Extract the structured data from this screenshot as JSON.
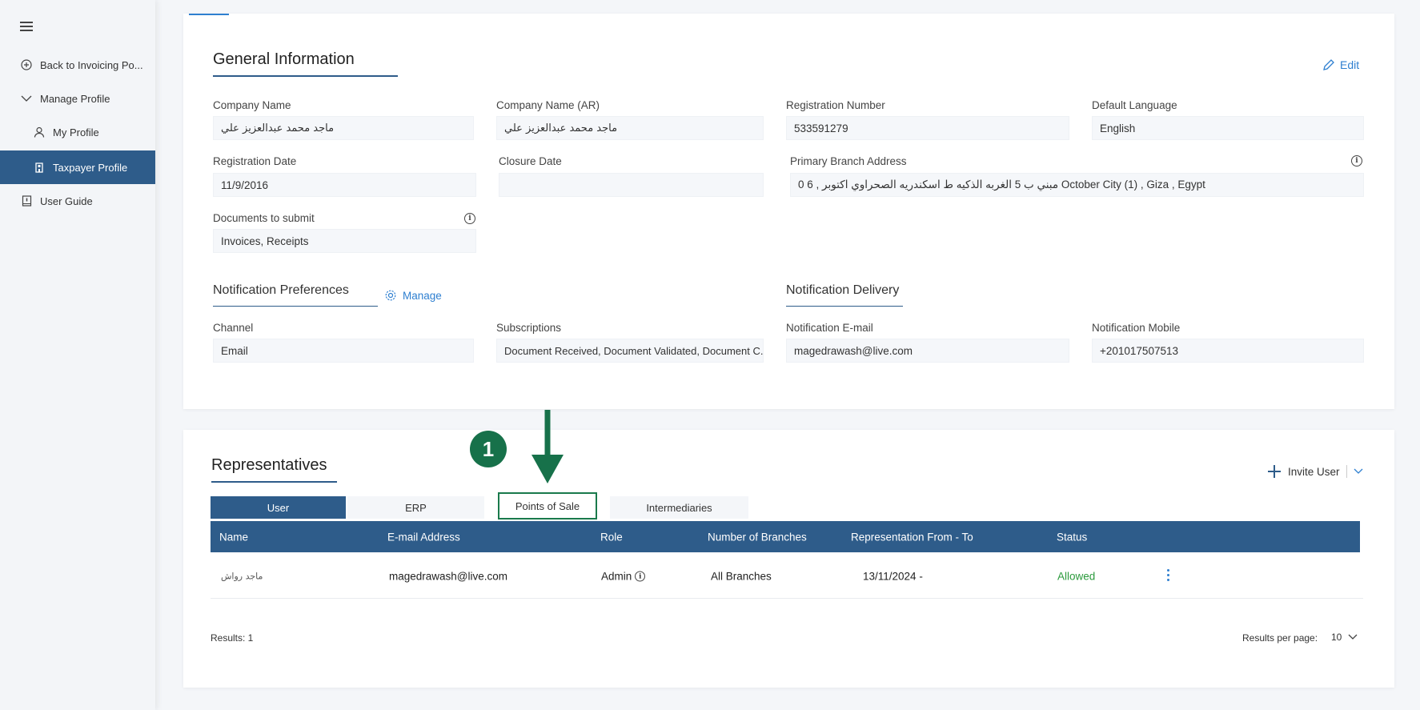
{
  "sidebar": {
    "items": [
      {
        "label": "Back to Invoicing Po..."
      },
      {
        "label": "Manage Profile"
      },
      {
        "label": "My Profile"
      },
      {
        "label": "Taxpayer Profile"
      },
      {
        "label": "User Guide"
      }
    ]
  },
  "general": {
    "title": "General Information",
    "edit_label": "Edit",
    "fields": {
      "company_name": {
        "label": "Company Name",
        "value": "ماجد محمد عبدالعزيز علي"
      },
      "company_name_ar": {
        "label": "Company Name (AR)",
        "value": "ماجد محمد عبدالعزيز علي"
      },
      "registration_number": {
        "label": "Registration Number",
        "value": "533591279"
      },
      "default_language": {
        "label": "Default Language",
        "value": "English"
      },
      "registration_date": {
        "label": "Registration Date",
        "value": "11/9/2016"
      },
      "closure_date": {
        "label": "Closure Date",
        "value": ""
      },
      "primary_branch_address": {
        "label": "Primary Branch Address",
        "value": "0  6 , مبني ب 5 الغربه الذكيه ط اسكندريه الصحراوي اكتوبر October City (1) , Giza , Egypt"
      },
      "documents_to_submit": {
        "label": "Documents to submit",
        "value": "Invoices, Receipts"
      }
    }
  },
  "notification_preferences": {
    "title": "Notification Preferences",
    "manage_label": "Manage",
    "channel": {
      "label": "Channel",
      "value": "Email"
    },
    "subscriptions": {
      "label": "Subscriptions",
      "value": "Document Received, Document Validated, Document C..."
    }
  },
  "notification_delivery": {
    "title": "Notification Delivery",
    "email": {
      "label": "Notification E-mail",
      "value": "magedrawash@live.com"
    },
    "mobile": {
      "label": "Notification Mobile",
      "value": "+201017507513"
    }
  },
  "representatives": {
    "title": "Representatives",
    "invite_label": "Invite User",
    "tabs": [
      "User",
      "ERP",
      "Points of Sale",
      "Intermediaries"
    ],
    "columns": [
      "Name",
      "E-mail Address",
      "Role",
      "Number of Branches",
      "Representation From - To",
      "Status"
    ],
    "rows": [
      {
        "name": "ماجد رواش",
        "email": "magedrawash@live.com",
        "role": "Admin",
        "branches": "All Branches",
        "from_to": "13/11/2024 -",
        "status": "Allowed"
      }
    ],
    "results_label": "Results: 1",
    "per_page_label": "Results per page:",
    "per_page_value": "10"
  },
  "annotation": {
    "step_number": "1"
  },
  "colors": {
    "primary": "#2e5c8a",
    "link": "#2e7fd0",
    "allowed": "#2b9a3c",
    "annotation": "#17714a"
  }
}
